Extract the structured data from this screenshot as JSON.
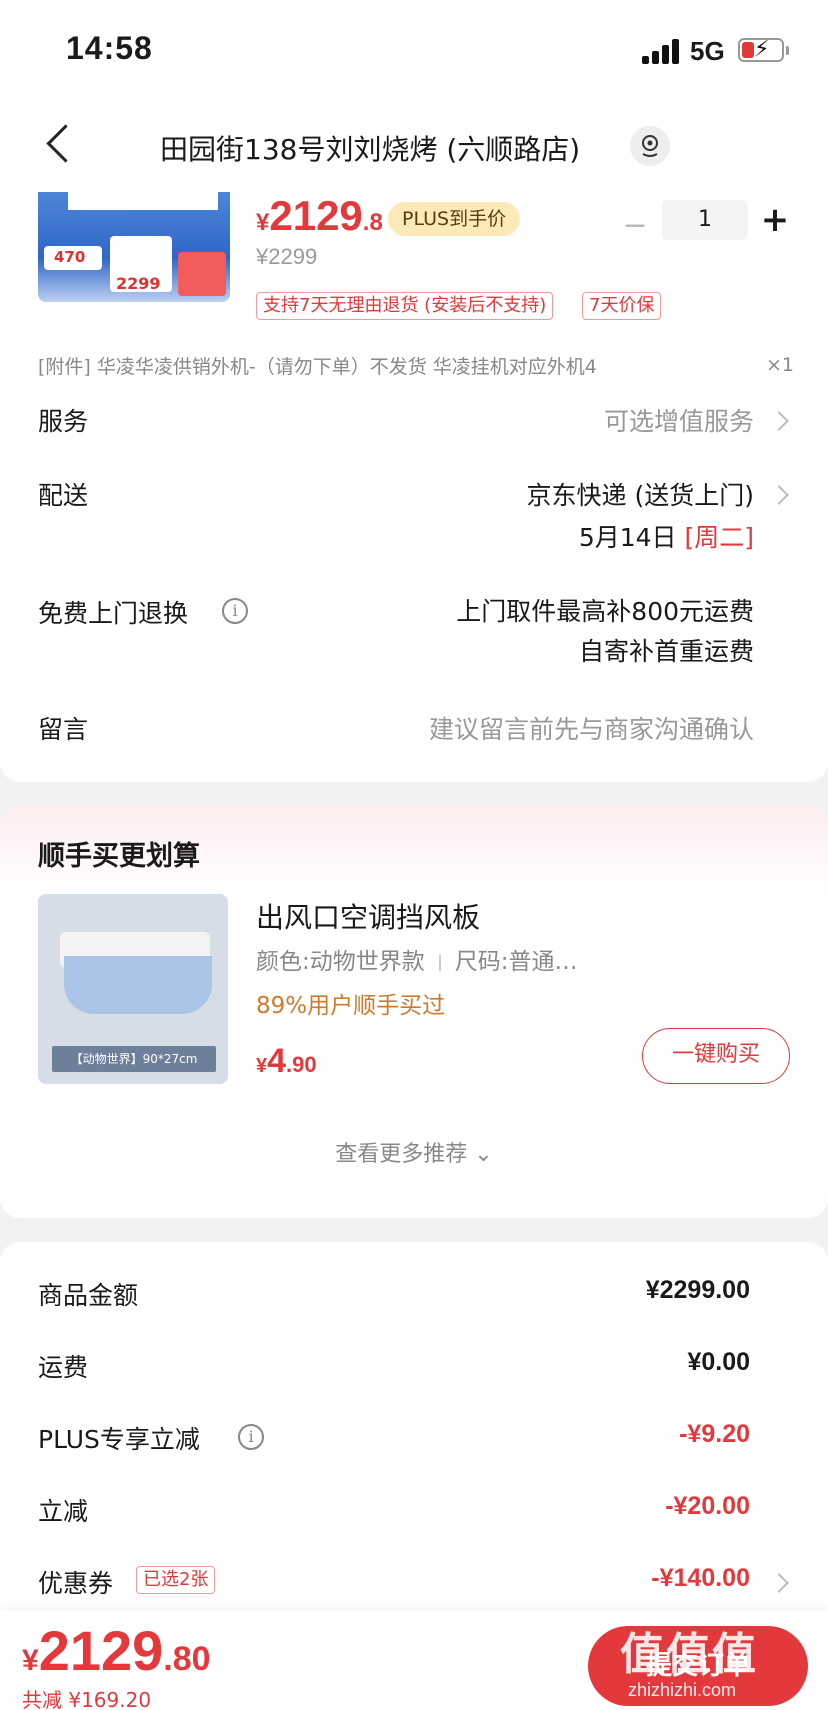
{
  "status_bar": {
    "time": "14:58",
    "network": "5G"
  },
  "nav": {
    "title": "田园街138号刘刘烧烤 (六顺路店)"
  },
  "product": {
    "price_symbol": "¥",
    "price_int": "2129",
    "price_dec": ".8",
    "plus_tag": "PLUS到手价",
    "original_price": "¥2299",
    "quantity": "1",
    "qty_minus": "−",
    "qty_plus": "+",
    "tags": [
      "支持7天无理由退货 (安装后不支持)",
      "7天价保"
    ],
    "image_text_1": "470",
    "image_text_2": "2299",
    "accessory": "[附件] 华凌华凌供销外机-（请勿下单）不发货 华凌挂机对应外机4",
    "accessory_count": "×1"
  },
  "rows": {
    "service_label": "服务",
    "service_value": "可选增值服务",
    "delivery_label": "配送",
    "delivery_value": "京东快递 (送货上门)",
    "delivery_date": "5月14日",
    "delivery_weekday": "[周二]",
    "return_label": "免费上门退换",
    "return_value_1": "上门取件最高补800元运费",
    "return_value_2": "自寄补首重运费",
    "message_label": "留言",
    "message_placeholder": "建议留言前先与商家沟通确认"
  },
  "recommend": {
    "title": "顺手买更划算",
    "item_name": "出风口空调挡风板",
    "spec_color": "颜色:动物世界款",
    "spec_size": "尺码:普通…",
    "stat": "89%用户顺手买过",
    "price_symbol": "¥",
    "price_int": "4",
    "price_dec": ".90",
    "buy_label": "一键购买",
    "image_caption": "【动物世界】90*27cm",
    "more_label": "查看更多推荐"
  },
  "summary": {
    "goods_label": "商品金额",
    "goods_value": "¥2299.00",
    "shipping_label": "运费",
    "shipping_value": "¥0.00",
    "plus_label": "PLUS专享立减",
    "plus_value": "-¥9.20",
    "instant_label": "立减",
    "instant_value": "-¥20.00",
    "coupon_label": "优惠券",
    "coupon_tag": "已选2张",
    "coupon_value": "-¥140.00"
  },
  "bottom": {
    "price_symbol": "¥",
    "price_int": "2129",
    "price_dec": ".80",
    "reduce_text": "共减 ¥169.20",
    "submit_label": "提交订单"
  },
  "watermark": {
    "logo": "值值值",
    "url": "zhizhizhi.com"
  },
  "colors": {
    "accent": "#e4393c",
    "plus_tag_bg": "#fbe9b7",
    "stat_orange": "#d07a2c"
  }
}
